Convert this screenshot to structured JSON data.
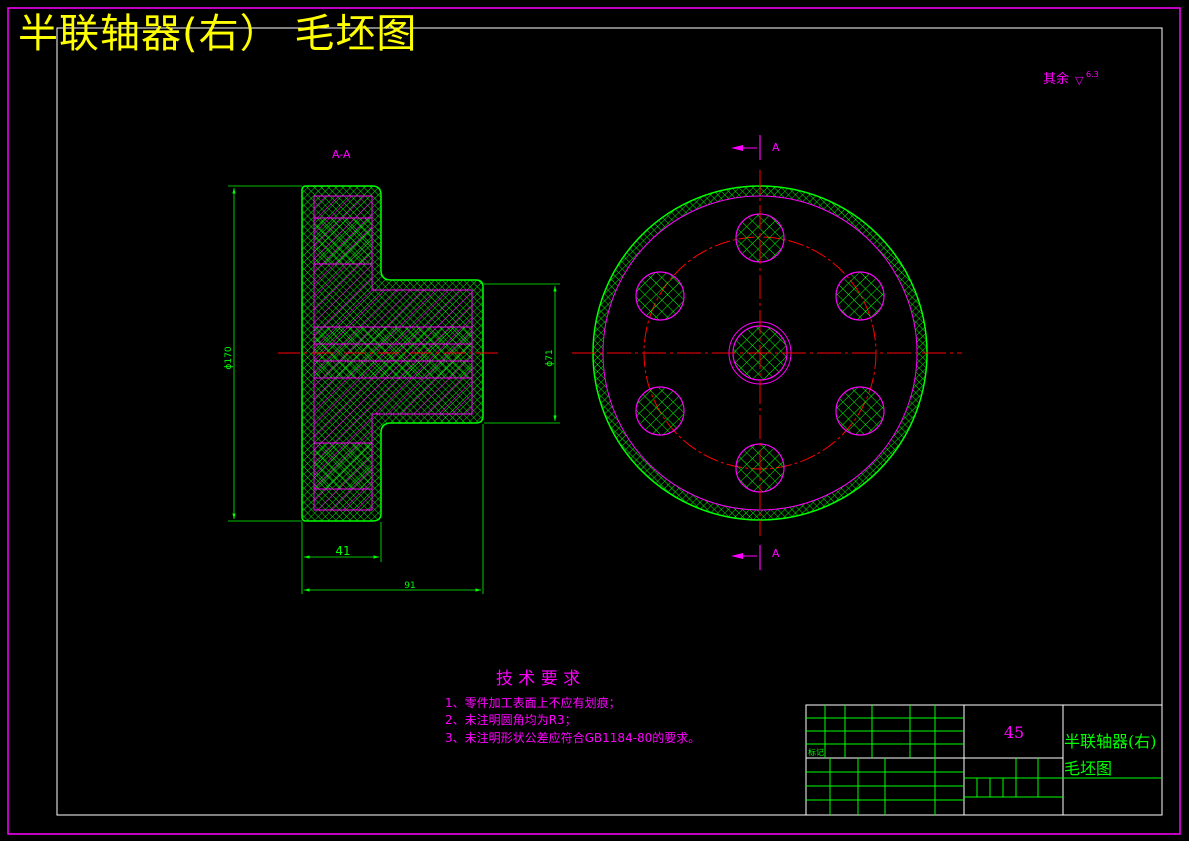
{
  "title": "半联轴器(右）  毛坯图",
  "roughness_note": {
    "label": "其余",
    "symbol": "▽",
    "value": "6.3"
  },
  "section_labels": {
    "section_view": "A-A",
    "cut_top": "A",
    "cut_bottom": "A"
  },
  "dimensions": {
    "outer_dia": "ϕ170",
    "hub_dia": "ϕ71",
    "flange_width": "41",
    "total_length": "91"
  },
  "tech_requirements": {
    "heading": "技 术 要 求",
    "items": [
      "1、零件加工表面上不应有划痕；",
      "2、未注明圆角均为R3；",
      "3、未注明形状公差应符合GB1184-80的要求。"
    ]
  },
  "title_block": {
    "material": "45",
    "part_name_line1": "半联轴器(右)",
    "part_name_line2": "毛坯图",
    "small_label": "标记"
  },
  "colors": {
    "frame": "#ff00ff",
    "outline": "#00ff00",
    "centerline": "#ff0000",
    "title": "#ffff00",
    "inner_border": "#ffffff"
  }
}
